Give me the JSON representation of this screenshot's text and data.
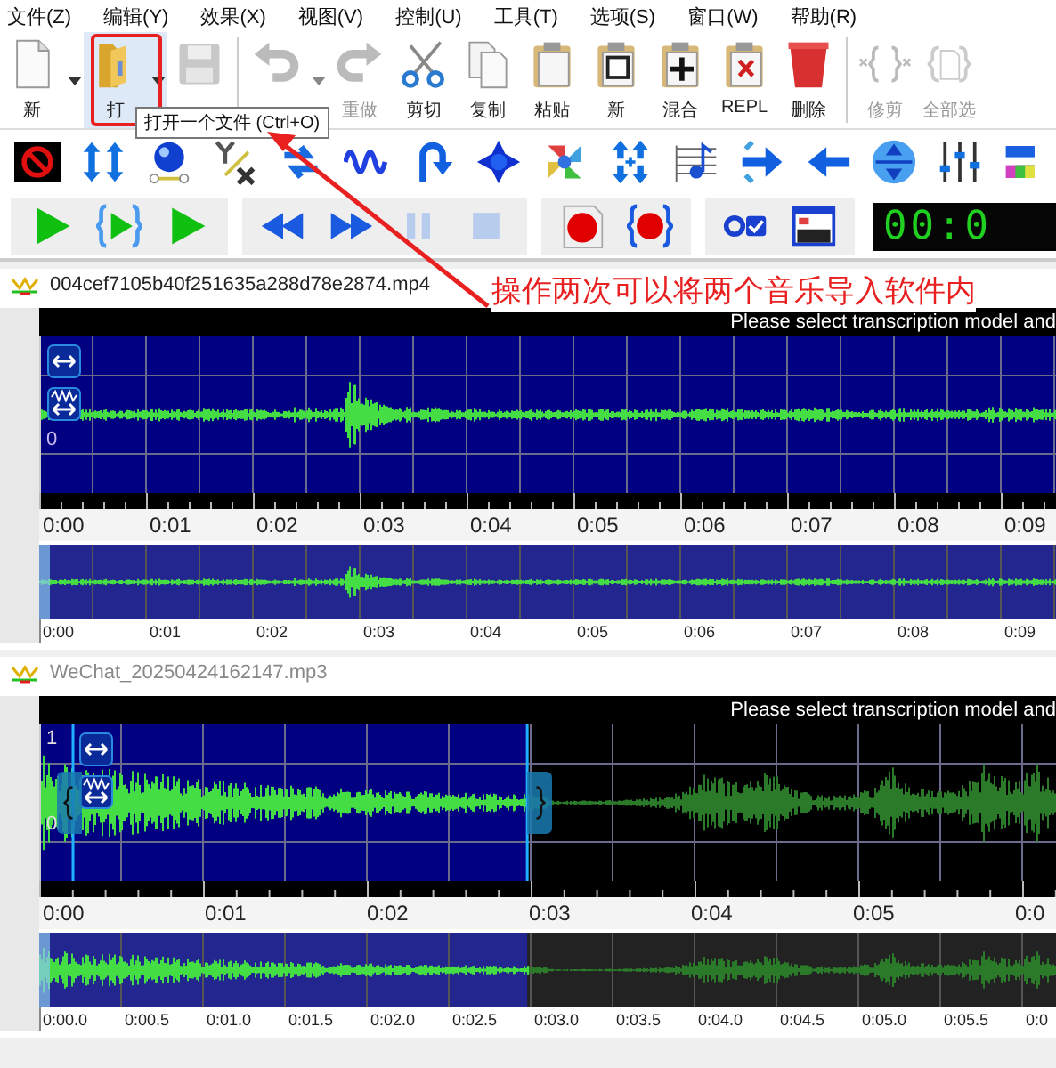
{
  "menu": [
    "文件(Z)",
    "编辑(Y)",
    "效果(X)",
    "视图(V)",
    "控制(U)",
    "工具(T)",
    "选项(S)",
    "窗口(W)",
    "帮助(R)"
  ],
  "toolbar": [
    {
      "kind": "new",
      "label": "新",
      "disabled": false,
      "dropdown": true,
      "hovered": false
    },
    {
      "kind": "open",
      "label": "打",
      "disabled": false,
      "dropdown": true,
      "hovered": true
    },
    {
      "kind": "save",
      "disabled": true,
      "dropdown": false,
      "hovered": false
    },
    {
      "kind": "undo",
      "disabled": true,
      "dropdown": true,
      "hovered": false
    },
    {
      "kind": "redo",
      "label": "重做",
      "disabled": true,
      "dropdown": false,
      "hovered": false
    },
    {
      "kind": "cut",
      "label": "剪切",
      "disabled": false,
      "dropdown": false,
      "hovered": false
    },
    {
      "kind": "copy",
      "label": "复制",
      "disabled": false,
      "dropdown": false,
      "hovered": false
    },
    {
      "kind": "paste",
      "label": "粘贴",
      "disabled": false,
      "dropdown": false,
      "hovered": false
    },
    {
      "kind": "paste-new",
      "label": "新",
      "disabled": false,
      "dropdown": false,
      "hovered": false
    },
    {
      "kind": "mix",
      "label": "混合",
      "disabled": false,
      "dropdown": false,
      "hovered": false
    },
    {
      "kind": "replace",
      "label": "REPL",
      "disabled": false,
      "dropdown": false,
      "hovered": false
    },
    {
      "kind": "delete",
      "label": "删除",
      "disabled": false,
      "dropdown": false,
      "hovered": false
    },
    {
      "kind": "trim",
      "label": "修剪",
      "disabled": true,
      "dropdown": false,
      "hovered": false
    },
    {
      "kind": "select-all",
      "label": "全部选",
      "disabled": true,
      "dropdown": false,
      "hovered": false
    }
  ],
  "tooltip": "打开一个文件 (Ctrl+O)",
  "time_display": "00:0",
  "annotation": {
    "text": "操作两次可以将两个音乐导入软件内"
  },
  "panels": [
    {
      "title": "004cef7105b40f251635a288d78e2874.mp4",
      "active": true,
      "info": "Please select transcription model and",
      "amplitude_labels": [
        "0"
      ],
      "selection": {
        "level": 1
      },
      "ruler": [
        "0:00",
        "0:01",
        "0:02",
        "0:03",
        "0:04",
        "0:05",
        "0:06",
        "0:07",
        "0:08",
        "0:09"
      ],
      "overview_ruler": [
        "0:00",
        "0:01",
        "0:02",
        "0:03",
        "0:04",
        "0:05",
        "0:06",
        "0:07",
        "0:08",
        "0:09"
      ]
    },
    {
      "title": "WeChat_20250424162147.mp3",
      "active": false,
      "info": "Please select transcription model and",
      "amplitude_labels": [
        "1",
        "0"
      ],
      "selection": {
        "level": 0.48
      },
      "ruler": [
        "0:00",
        "0:01",
        "0:02",
        "0:03",
        "0:04",
        "0:05",
        "0:0"
      ],
      "overview_ruler": [
        "0:00.0",
        "0:00.5",
        "0:01.0",
        "0:01.5",
        "0:02.0",
        "0:02.5",
        "0:03.0",
        "0:03.5",
        "0:04.0",
        "0:04.5",
        "0:05.0",
        "0:05.5",
        "0:0"
      ]
    }
  ]
}
